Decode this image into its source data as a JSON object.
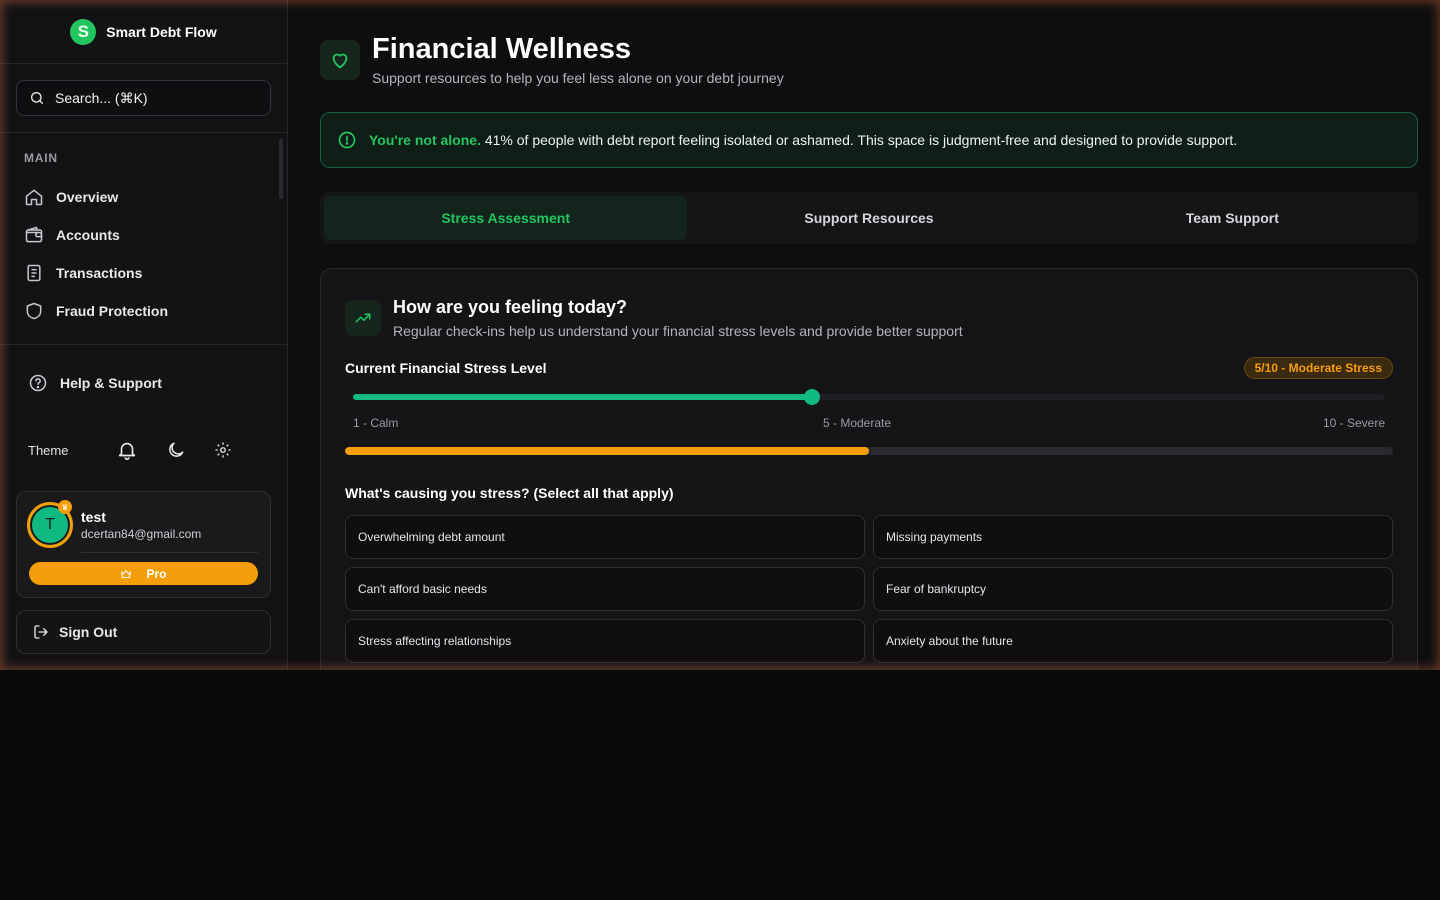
{
  "brand": {
    "name": "Smart Debt Flow",
    "logo_letter": "S"
  },
  "search": {
    "placeholder": "Search... (⌘K)"
  },
  "sidebar": {
    "section_label": "MAIN",
    "items": [
      {
        "label": "Overview",
        "icon": "home-icon"
      },
      {
        "label": "Accounts",
        "icon": "wallet-icon"
      },
      {
        "label": "Transactions",
        "icon": "document-icon"
      },
      {
        "label": "Fraud Protection",
        "icon": "shield-icon"
      }
    ],
    "help_label": "Help & Support",
    "theme_label": "Theme"
  },
  "user": {
    "initial": "T",
    "name": "test",
    "email": "dcertan84@gmail.com",
    "plan_label": "Pro"
  },
  "signout_label": "Sign Out",
  "page": {
    "title": "Financial Wellness",
    "subtitle": "Support resources to help you feel less alone on your debt journey"
  },
  "alert": {
    "strong": "You're not alone.",
    "text": "41% of people with debt report feeling isolated or ashamed. This space is judgment-free and designed to provide support."
  },
  "tabs": [
    {
      "label": "Stress Assessment",
      "active": true
    },
    {
      "label": "Support Resources",
      "active": false
    },
    {
      "label": "Team Support",
      "active": false
    }
  ],
  "assessment": {
    "title": "How are you feeling today?",
    "subtitle": "Regular check-ins help us understand your financial stress levels and provide better support",
    "stress_label": "Current Financial Stress Level",
    "badge": "5/10 - Moderate Stress",
    "level": 5,
    "min": 1,
    "max": 10,
    "ticks": {
      "low": "1 - Calm",
      "mid": "5 - Moderate",
      "high": "10 - Severe"
    },
    "progress_fraction": 0.5,
    "causes_label": "What's causing you stress? (Select all that apply)",
    "causes": [
      "Overwhelming debt amount",
      "Missing payments",
      "Can't afford basic needs",
      "Fear of bankruptcy",
      "Stress affecting relationships",
      "Anxiety about the future"
    ]
  },
  "colors": {
    "accent": "#22c55e",
    "warning": "#f59e0b",
    "background": "#0e0e10"
  }
}
